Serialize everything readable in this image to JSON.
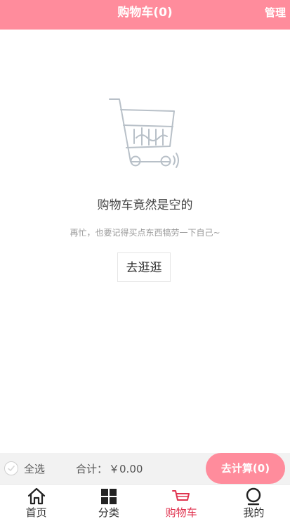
{
  "header": {
    "title": "购物车(0)",
    "manage_label": "管理"
  },
  "empty_state": {
    "icon": "empty-cart-icon",
    "title": "购物车竟然是空的",
    "subtitle": "再忙，也要记得买点东西犒劳一下自己~",
    "button_label": "去逛逛"
  },
  "checkout_bar": {
    "select_all_label": "全选",
    "total_label": "合计：",
    "total_amount": "￥0.00",
    "checkout_label": "去计算(0)"
  },
  "tabbar": {
    "items": [
      {
        "label": "首页",
        "icon": "home-icon",
        "active": false
      },
      {
        "label": "分类",
        "icon": "category-grid-icon",
        "active": false
      },
      {
        "label": "购物车",
        "icon": "cart-icon",
        "active": true
      },
      {
        "label": "我的",
        "icon": "profile-icon",
        "active": false
      }
    ]
  },
  "colors": {
    "primary": "#ff8c9c",
    "active_tab": "#e0334f"
  }
}
